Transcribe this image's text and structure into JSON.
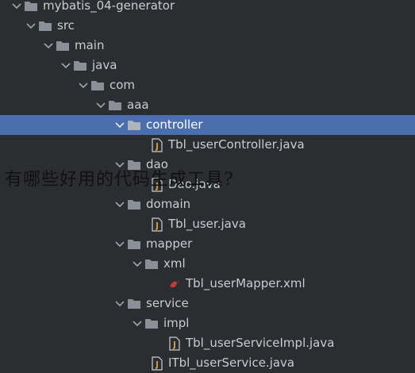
{
  "tree": {
    "project": "mybatis_04-generator",
    "src": "src",
    "main": "main",
    "java": "java",
    "com": "com",
    "aaa": "aaa",
    "controller": "controller",
    "controller_file": "Tbl_userController.java",
    "dao": "dao",
    "dao_file": "Dao.java",
    "domain": "domain",
    "domain_file": "Tbl_user.java",
    "mapper": "mapper",
    "xml": "xml",
    "xml_file": "Tbl_userMapper.xml",
    "service": "service",
    "impl": "impl",
    "impl_file": "Tbl_userServiceImpl.java",
    "service_file": "ITbl_userService.java"
  },
  "overlay": {
    "question": "有哪些好用的代码生成工具?"
  },
  "colors": {
    "background": "#2b2d30",
    "selection": "#4b6eaf",
    "folder": "#8b9098",
    "java_file": "#c9cdd3"
  }
}
